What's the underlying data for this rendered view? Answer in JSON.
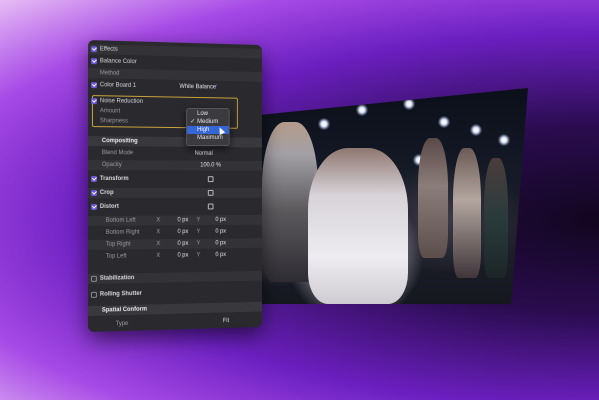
{
  "inspector": {
    "effects_label": "Effects",
    "balance_color_label": "Balance Color",
    "method_label": "Method",
    "method_value": "White Balance",
    "color_board_label": "Color Board 1",
    "noise_reduction_label": "Noise Reduction",
    "amount_label": "Amount",
    "sharpness_label": "Sharpness",
    "compositing_label": "Compositing",
    "blend_mode_label": "Blend Mode",
    "blend_mode_value": "Normal",
    "opacity_label": "Opacity",
    "opacity_value": "100.0 %",
    "transform_label": "Transform",
    "crop_label": "Crop",
    "distort_label": "Distort",
    "bottom_left_label": "Bottom Left",
    "bottom_right_label": "Bottom Right",
    "top_right_label": "Top Right",
    "top_left_label": "Top Left",
    "x_label": "X",
    "y_label": "Y",
    "zero_px": "0 px",
    "stabilization_label": "Stabilization",
    "rolling_shutter_label": "Rolling Shutter",
    "spatial_conform_label": "Spatial Conform",
    "type_label": "Type",
    "type_value": "Fit"
  },
  "amount_menu": {
    "options": [
      "Low",
      "Medium",
      "High",
      "Maximum"
    ],
    "checked": "Medium",
    "highlighted": "High"
  },
  "colors": {
    "accent_checkbox": "#6c56d9",
    "menu_highlight": "#3566d6",
    "selection_outline": "#c8a43a"
  }
}
